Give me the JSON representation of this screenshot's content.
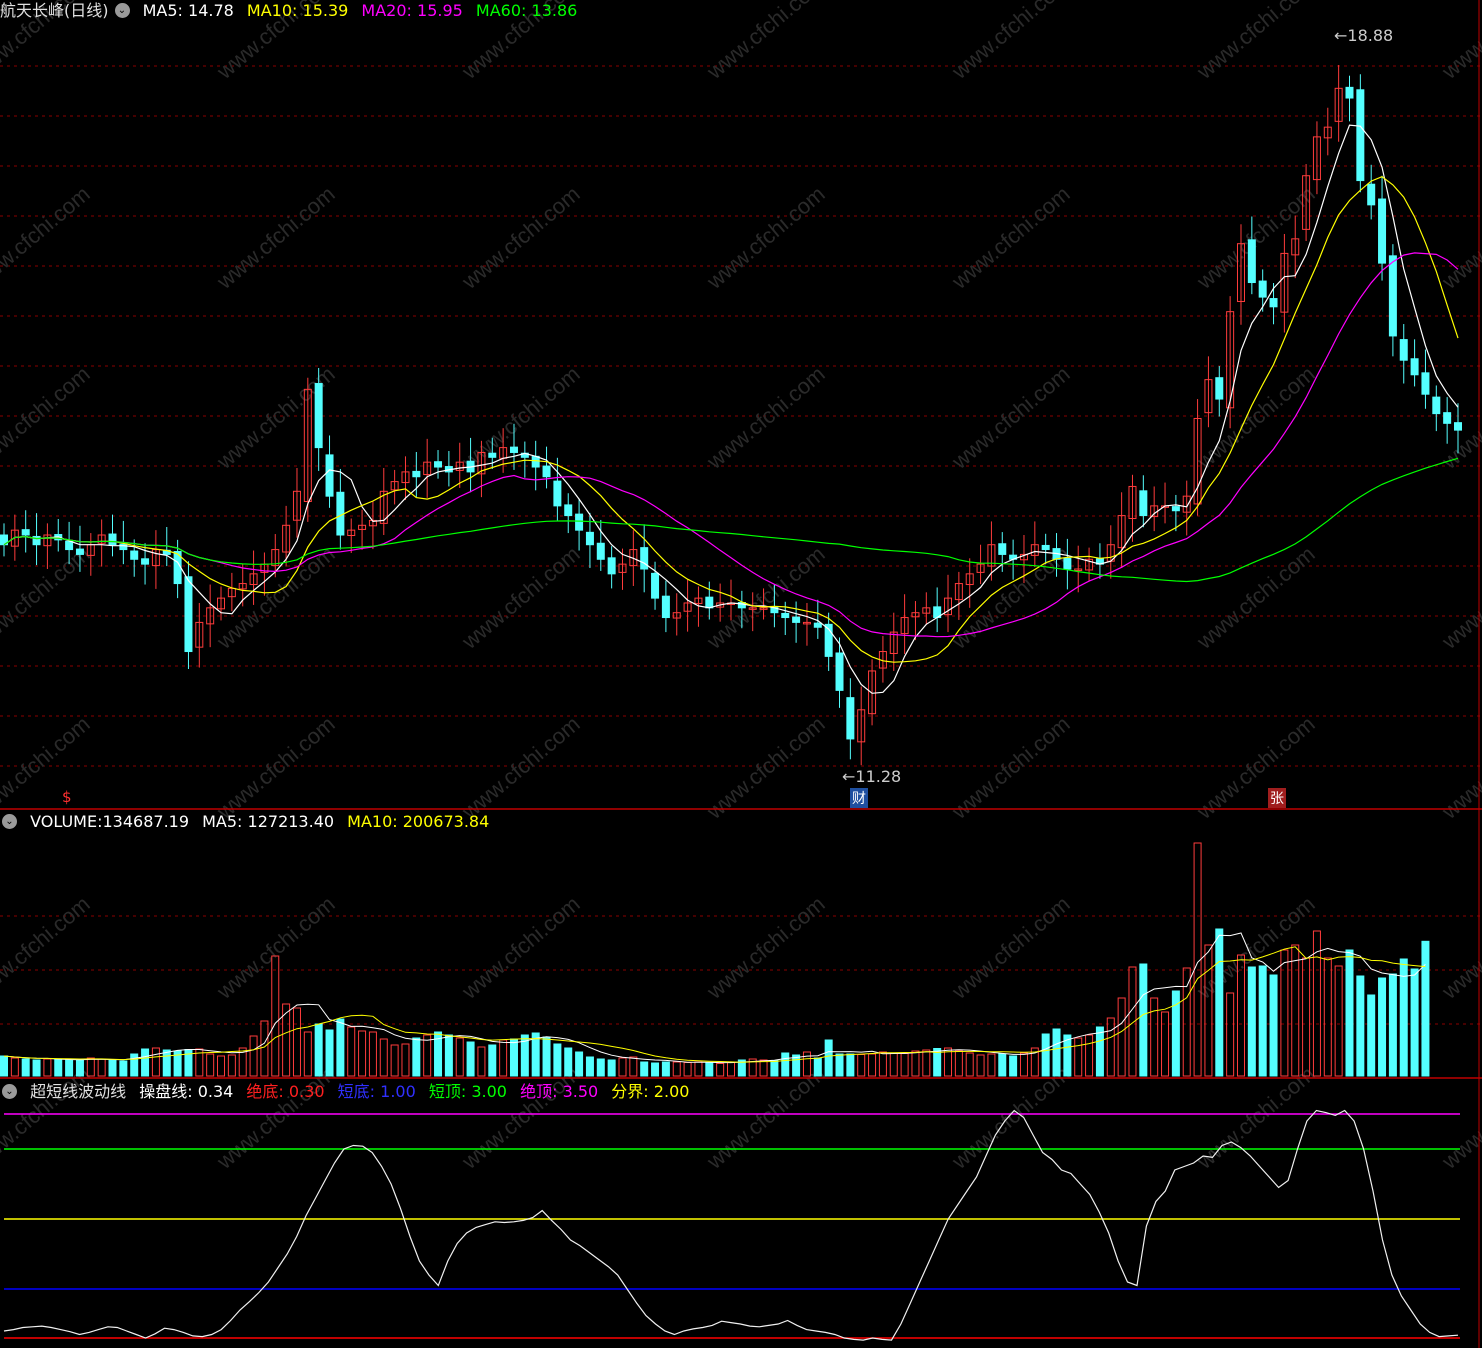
{
  "main_panel": {
    "stock_name": "航天长峰(日线)",
    "ma5_label": "MA5:",
    "ma5_value": "14.78",
    "ma10_label": "MA10:",
    "ma10_value": "15.39",
    "ma20_label": "MA20:",
    "ma20_value": "15.95",
    "ma60_label": "MA60:",
    "ma60_value": "13.86",
    "high_marker": "18.88",
    "low_marker": "11.28",
    "badge_left": "$",
    "badge_finance": "财",
    "badge_rise": "张"
  },
  "volume_panel": {
    "volume_label": "VOLUME:",
    "volume_value": "134687.19",
    "ma5_label": "MA5:",
    "ma5_value": "127213.40",
    "ma10_label": "MA10:",
    "ma10_value": "200673.84"
  },
  "oscillator_panel": {
    "title": "超短线波动线",
    "line_label": "操盘线:",
    "line_value": "0.34",
    "abs_bottom_label": "绝底:",
    "abs_bottom_value": "0.30",
    "short_bottom_label": "短底:",
    "short_bottom_value": "1.00",
    "short_top_label": "短顶:",
    "short_top_value": "3.00",
    "abs_top_label": "绝顶:",
    "abs_top_value": "3.50",
    "divide_label": "分界:",
    "divide_value": "2.00"
  },
  "watermark": "www.cfchi.com",
  "colors": {
    "up": "#ff3c3c",
    "down": "#54ffff",
    "ma5": "#ffffff",
    "ma10": "#ffff00",
    "ma20": "#ff00ff",
    "ma60": "#00ff00",
    "grid": "#8a0000",
    "divider": "#c00000",
    "abs_top": "#ff00ff",
    "short_top": "#00ff00",
    "divide": "#ffff00",
    "short_bottom": "#0000ff",
    "abs_bottom": "#ff0000"
  },
  "chart_data": [
    {
      "type": "candlestick",
      "title": "航天长峰(日线)",
      "price_high": 18.88,
      "price_low": 11.28,
      "close": [
        13.6,
        13.75,
        13.7,
        13.6,
        13.7,
        13.65,
        13.55,
        13.5,
        13.6,
        13.7,
        13.6,
        13.55,
        13.45,
        13.4,
        13.55,
        13.5,
        13.2,
        12.5,
        12.8,
        12.95,
        13.05,
        13.15,
        13.2,
        13.3,
        13.4,
        13.55,
        13.8,
        14.15,
        15.2,
        14.6,
        14.1,
        13.7,
        13.75,
        13.8,
        13.85,
        14.15,
        14.25,
        14.35,
        14.3,
        14.45,
        14.4,
        14.35,
        14.45,
        14.35,
        14.55,
        14.5,
        14.6,
        14.55,
        14.5,
        14.4,
        14.3,
        14.0,
        13.9,
        13.75,
        13.6,
        13.45,
        13.3,
        13.4,
        13.55,
        13.35,
        13.05,
        12.85,
        12.9,
        13.0,
        13.05,
        12.95,
        13.0,
        13.0,
        12.95,
        12.95,
        12.95,
        12.9,
        12.85,
        12.8,
        12.8,
        12.75,
        12.45,
        12.1,
        11.6,
        11.9,
        12.3,
        12.5,
        12.7,
        12.85,
        12.9,
        12.95,
        12.85,
        13.05,
        13.2,
        13.3,
        13.4,
        13.6,
        13.5,
        13.45,
        13.5,
        13.6,
        13.55,
        13.45,
        13.35,
        13.35,
        13.45,
        13.4,
        13.6,
        13.9,
        14.2,
        13.9,
        14.0,
        14.0,
        13.95,
        14.1,
        14.9,
        15.3,
        15.1,
        16.0,
        16.7,
        16.3,
        16.15,
        16.05,
        16.6,
        16.75,
        17.4,
        17.8,
        17.9,
        18.3,
        18.2,
        17.35,
        17.1,
        16.5,
        15.75,
        15.5,
        15.35,
        15.15,
        14.95,
        14.85,
        14.78
      ]
    },
    {
      "type": "bar",
      "title": "VOLUME",
      "series": [
        {
          "name": "VOLUME",
          "values": [
            20000,
            18000,
            17000,
            16000,
            17000,
            16500,
            16000,
            15500,
            18000,
            17000,
            16000,
            15000,
            22000,
            27000,
            28000,
            26000,
            25000,
            26500,
            27000,
            22000,
            20000,
            21000,
            28000,
            40000,
            55000,
            120000,
            72000,
            68000,
            44000,
            52000,
            46000,
            57000,
            49000,
            45000,
            44000,
            37000,
            31000,
            32000,
            38000,
            41000,
            44000,
            41000,
            38000,
            34000,
            29000,
            31000,
            36000,
            37000,
            41000,
            43000,
            39000,
            32000,
            28000,
            24000,
            19000,
            17000,
            16000,
            18000,
            19000,
            14000,
            13000,
            14000,
            14000,
            13500,
            14000,
            13000,
            12500,
            14000,
            16000,
            17000,
            16000,
            15500,
            23000,
            21000,
            24000,
            18000,
            36000,
            22000,
            22000,
            21500,
            22000,
            24000,
            23000,
            22500,
            25000,
            26000,
            27500,
            28000,
            25000,
            23000,
            21000,
            22000,
            22000,
            20000,
            23000,
            28000,
            42000,
            47000,
            41000,
            38000,
            41000,
            49000,
            58000,
            78000,
            109000,
            112000,
            78000,
            64000,
            85000,
            108000,
            233000,
            131000,
            147000,
            83000,
            121000,
            109000,
            110000,
            101000,
            126000,
            131000,
            118000,
            145000,
            118000,
            110000,
            126000,
            100000,
            81000,
            98000,
            102000,
            117000,
            107000,
            134687
          ]
        }
      ]
    },
    {
      "type": "line",
      "title": "超短线波动线",
      "series": [
        {
          "name": "操盘线",
          "values": [
            0.4,
            0.42,
            0.45,
            0.46,
            0.47,
            0.45,
            0.42,
            0.39,
            0.35,
            0.38,
            0.42,
            0.46,
            0.45,
            0.4,
            0.35,
            0.3,
            0.36,
            0.44,
            0.42,
            0.38,
            0.33,
            0.32,
            0.35,
            0.42,
            0.55,
            0.7,
            0.82,
            0.95,
            1.1,
            1.3,
            1.5,
            1.75,
            2.05,
            2.3,
            2.55,
            2.8,
            3.0,
            3.05,
            3.04,
            2.95,
            2.75,
            2.5,
            2.15,
            1.75,
            1.4,
            1.2,
            1.05,
            1.4,
            1.65,
            1.8,
            1.88,
            1.92,
            1.96,
            1.95,
            1.96,
            1.98,
            2.02,
            2.12,
            1.98,
            1.85,
            1.7,
            1.62,
            1.52,
            1.42,
            1.32,
            1.2,
            1.0,
            0.8,
            0.62,
            0.5,
            0.4,
            0.35,
            0.4,
            0.43,
            0.45,
            0.48,
            0.54,
            0.52,
            0.5,
            0.47,
            0.46,
            0.48,
            0.5,
            0.55,
            0.48,
            0.42,
            0.4,
            0.38,
            0.35,
            0.3,
            0.28,
            0.27,
            0.3,
            0.28,
            0.27,
            0.5,
            0.8,
            1.1,
            1.4,
            1.7,
            2.0,
            2.2,
            2.4,
            2.6,
            2.9,
            3.2,
            3.4,
            3.55,
            3.45,
            3.2,
            2.95,
            2.85,
            2.7,
            2.65,
            2.5,
            2.35,
            2.1,
            1.8,
            1.4,
            1.1,
            1.05,
            1.9,
            2.25,
            2.4,
            2.7,
            2.75,
            2.8,
            2.9,
            2.88,
            3.05,
            3.1,
            3.02,
            2.9,
            2.75,
            2.6,
            2.45,
            2.55,
            3.0,
            3.4,
            3.55,
            3.52,
            3.48,
            3.55,
            3.4,
            3.0,
            2.4,
            1.7,
            1.2,
            0.9,
            0.7,
            0.5,
            0.38,
            0.32,
            0.33,
            0.34
          ]
        }
      ],
      "reference_lines": [
        {
          "name": "绝顶",
          "value": 3.5
        },
        {
          "name": "短顶",
          "value": 3.0
        },
        {
          "name": "分界",
          "value": 2.0
        },
        {
          "name": "短底",
          "value": 1.0
        },
        {
          "name": "绝底",
          "value": 0.3
        }
      ]
    }
  ]
}
